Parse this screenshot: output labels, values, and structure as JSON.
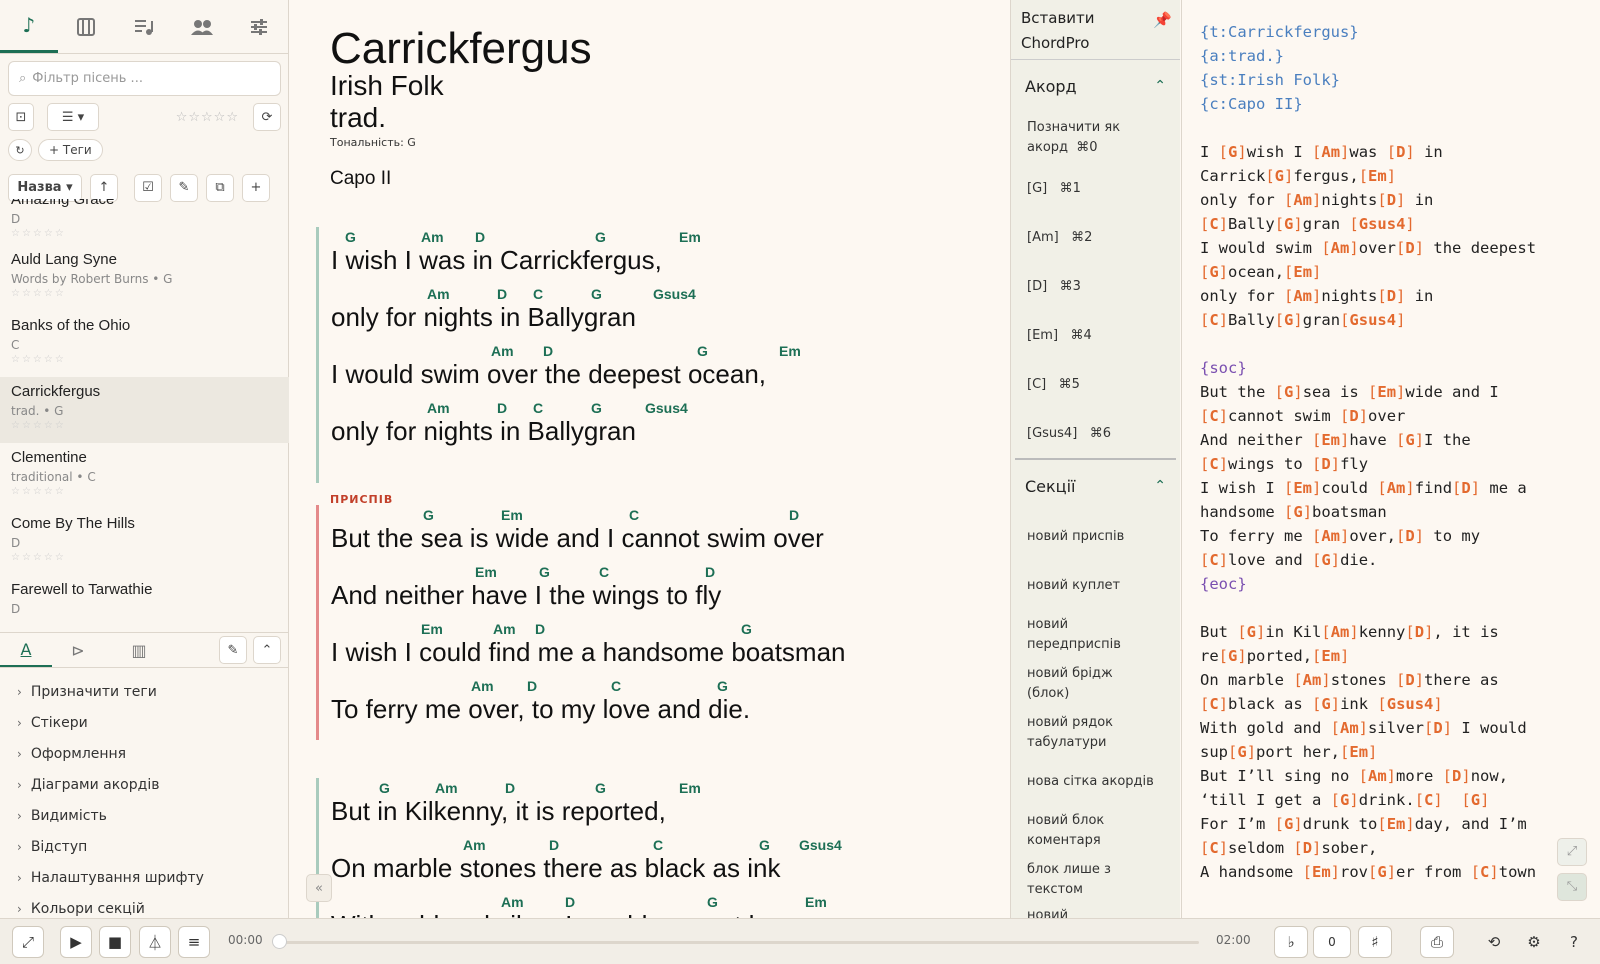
{
  "sidebar": {
    "search_placeholder": "Фільтр пісень ...",
    "tags_button": "+ Теги",
    "sort_label": "Назва",
    "top_tabs": [
      "music-note-icon",
      "piano-icon",
      "playlist-icon",
      "people-icon",
      "sliders-icon"
    ],
    "songs": [
      {
        "title": "Amazing Grace",
        "meta": "D"
      },
      {
        "title": "Auld Lang Syne",
        "meta": "Words by Robert Burns • G"
      },
      {
        "title": "Banks of the Ohio",
        "meta": "C"
      },
      {
        "title": "Carrickfergus",
        "meta": "trad. • G"
      },
      {
        "title": "Clementine",
        "meta": "traditional • C"
      },
      {
        "title": "Come By The Hills",
        "meta": "D"
      },
      {
        "title": "Farewell to Tarwathie",
        "meta": "D"
      }
    ],
    "options": [
      "Призначити теги",
      "Стікери",
      "Оформлення",
      "Діаграми акордів",
      "Видимість",
      "Відступ",
      "Налаштування шрифту",
      "Кольори секцій"
    ]
  },
  "song": {
    "title": "Carrickfergus",
    "subtitle": "Irish Folk",
    "artist": "trad.",
    "key": "Тональність: G",
    "capo": "Capo II",
    "chorus_label": "ПРИСПІВ"
  },
  "insert_panel": {
    "header": "Вставити ChordPro",
    "chord_section": "Акорд",
    "mark_as_chord": "Позначити як акорд",
    "mark_shortcut": "⌘0",
    "chords": [
      {
        "label": "[G]",
        "shortcut": "⌘1"
      },
      {
        "label": "[Am]",
        "shortcut": "⌘2"
      },
      {
        "label": "[D]",
        "shortcut": "⌘3"
      },
      {
        "label": "[Em]",
        "shortcut": "⌘4"
      },
      {
        "label": "[C]",
        "shortcut": "⌘5"
      },
      {
        "label": "[Gsus4]",
        "shortcut": "⌘6"
      }
    ],
    "sections_title": "Секції",
    "sections": [
      "новий приспів",
      "новий куплет",
      "новий передприспів",
      "новий брідж (блок)",
      "новий рядок табулатури",
      "нова сітка акордів",
      "новий блок коментаря",
      "блок лише з текстом",
      "новий"
    ]
  },
  "player": {
    "time_start": "00:00",
    "time_end": "02:00",
    "transpose_value": "0",
    "flat": "♭",
    "sharp": "♯"
  }
}
